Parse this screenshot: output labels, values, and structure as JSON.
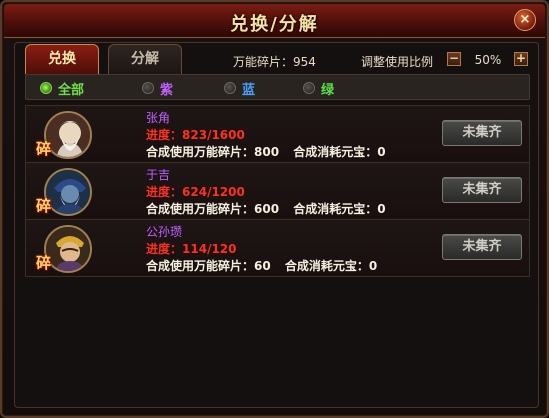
{
  "window": {
    "title": "兑换/分解",
    "close_label": "×"
  },
  "tabs": [
    {
      "label": "兑换"
    },
    {
      "label": "分解"
    }
  ],
  "shards": {
    "label": "万能碎片：",
    "value": "954"
  },
  "ratio": {
    "label": "调整使用比例",
    "minus": "−",
    "plus": "+",
    "value": "50%"
  },
  "filters": [
    {
      "label": "全部",
      "color": "#6ee04a",
      "selected": true
    },
    {
      "label": "紫",
      "color": "#c060ff",
      "selected": false
    },
    {
      "label": "蓝",
      "color": "#4aa0ff",
      "selected": false
    },
    {
      "label": "绿",
      "color": "#5ae04a",
      "selected": false
    }
  ],
  "generals": [
    {
      "name": "张角",
      "badge": "碎",
      "progress_label": "进度：",
      "progress": "823/1600",
      "shard_cost_label": "合成使用万能碎片：",
      "shard_cost": "800",
      "gold_cost_label": "合成消耗元宝：",
      "gold_cost": "0",
      "button": "未集齐"
    },
    {
      "name": "于吉",
      "badge": "碎",
      "progress_label": "进度：",
      "progress": "624/1200",
      "shard_cost_label": "合成使用万能碎片：",
      "shard_cost": "600",
      "gold_cost_label": "合成消耗元宝：",
      "gold_cost": "0",
      "button": "未集齐"
    },
    {
      "name": "公孙瓒",
      "badge": "碎",
      "progress_label": "进度：",
      "progress": "114/120",
      "shard_cost_label": "合成使用万能碎片：",
      "shard_cost": "60",
      "gold_cost_label": "合成消耗元宝：",
      "gold_cost": "0",
      "button": "未集齐"
    }
  ]
}
